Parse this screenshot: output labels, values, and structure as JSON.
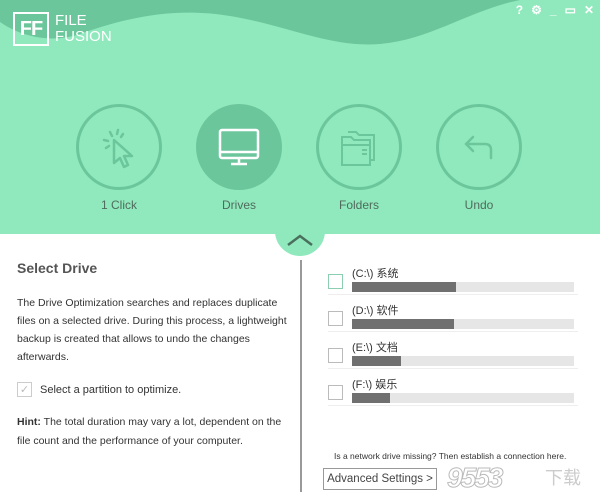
{
  "app": {
    "logo_mark": "FF",
    "logo_line1": "FILE",
    "logo_line2": "FUSION"
  },
  "window_controls": {
    "help": "?",
    "settings": "⚙",
    "minimize": "_",
    "maximize": "▭",
    "close": "✕"
  },
  "nav": {
    "items": [
      {
        "label": "1 Click",
        "icon": "cursor-click-icon",
        "active": false
      },
      {
        "label": "Drives",
        "icon": "monitor-icon",
        "active": true
      },
      {
        "label": "Folders",
        "icon": "folders-icon",
        "active": false
      },
      {
        "label": "Undo",
        "icon": "undo-arrow-icon",
        "active": false
      }
    ]
  },
  "left_panel": {
    "title": "Select Drive",
    "description": "The Drive Optimization searches and replaces duplicate files on a selected drive. During this process, a lightweight backup is created that allows to undo the changes afterwards.",
    "check_label": "Select a partition to optimize.",
    "hint_label": "Hint:",
    "hint_text": " The total duration may vary a lot, dependent on the file count and the performance of your computer."
  },
  "drives": [
    {
      "label": "(C:\\) 系统",
      "used_fraction": 0.47,
      "checked": false
    },
    {
      "label": "(D:\\) 软件",
      "used_fraction": 0.46,
      "checked": false
    },
    {
      "label": "(E:\\) 文档",
      "used_fraction": 0.22,
      "checked": false
    },
    {
      "label": "(F:\\) 娱乐",
      "used_fraction": 0.17,
      "checked": false
    }
  ],
  "footer": {
    "network_link": "Is a network drive missing? Then establish a connection here.",
    "advanced_settings": "Advanced Settings >",
    "watermark": "9553",
    "watermark_suffix": "下载"
  },
  "colors": {
    "header_bg": "#90e9bd",
    "header_dark": "#6cc69c",
    "bar_fill": "#707070",
    "bar_track": "#e6e6e6"
  }
}
